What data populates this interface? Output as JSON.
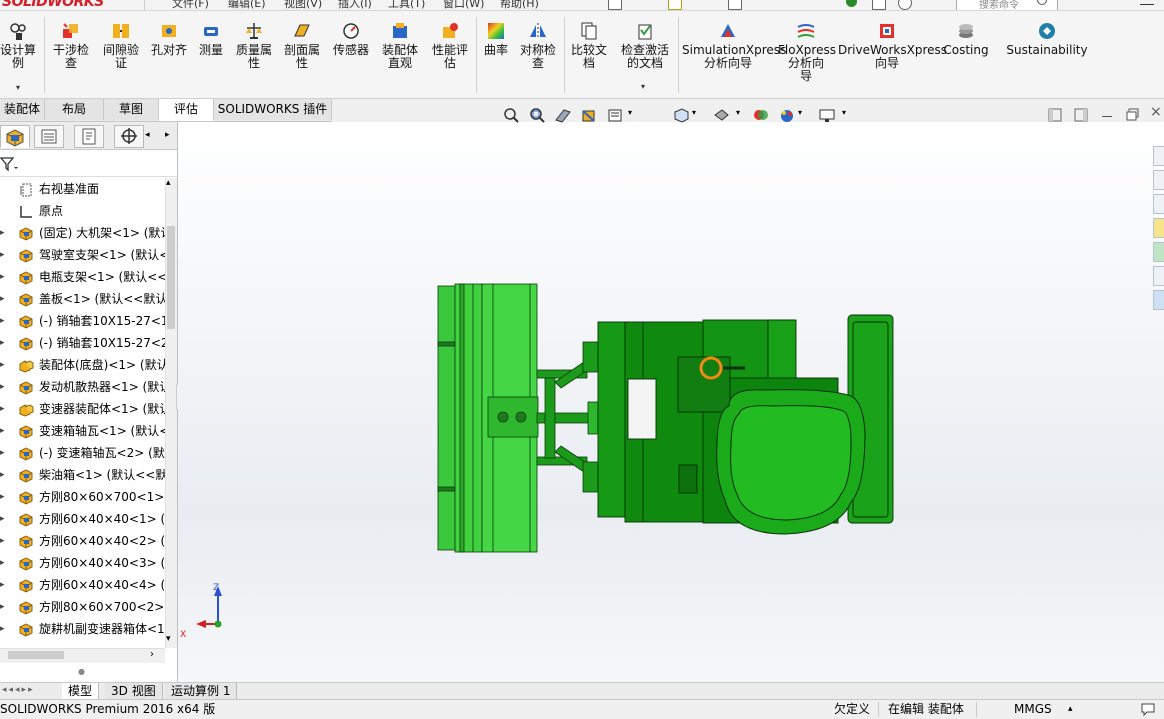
{
  "app": {
    "logo_text": "SOLIDWORKS",
    "menu": [
      "文件(F)",
      "编辑(E)",
      "视图(V)",
      "插入(I)",
      "工具(T)",
      "窗口(W)",
      "帮助(H)"
    ],
    "search_placeholder": "搜索命令"
  },
  "ribbon": {
    "commands": [
      {
        "label": "设计算\n例",
        "icon": "design-study-icon"
      },
      {
        "label": "干涉检\n查",
        "icon": "interference-check-icon"
      },
      {
        "label": "间隙验\n证",
        "icon": "clearance-verification-icon"
      },
      {
        "label": "孔对齐",
        "icon": "hole-alignment-icon"
      },
      {
        "label": "测量",
        "icon": "measure-icon"
      },
      {
        "label": "质量属\n性",
        "icon": "mass-properties-icon"
      },
      {
        "label": "剖面属\n性",
        "icon": "section-properties-icon"
      },
      {
        "label": "传感器",
        "icon": "sensor-icon"
      },
      {
        "label": "装配体\n直观",
        "icon": "assemblyxpert-icon"
      },
      {
        "label": "性能评\n估",
        "icon": "performance-evaluation-icon"
      },
      {
        "label": "曲率",
        "icon": "curvature-icon"
      },
      {
        "label": "对称检\n查",
        "icon": "symmetry-check-icon"
      },
      {
        "label": "比较文\n档",
        "icon": "compare-documents-icon"
      },
      {
        "label": "检查激活\n的文档",
        "icon": "check-active-document-icon"
      },
      {
        "label": "SimulationXpress\n分析向导",
        "icon": "simulationxpress-icon"
      },
      {
        "label": "FloXpress\n分析向\n导",
        "icon": "floxpress-icon"
      },
      {
        "label": "DriveWorksXpress\n向导",
        "icon": "driveworksxpress-icon"
      },
      {
        "label": "Costing",
        "icon": "costing-icon"
      },
      {
        "label": "Sustainability",
        "icon": "sustainability-icon"
      }
    ]
  },
  "tabs": [
    {
      "label": "装配体"
    },
    {
      "label": "布局"
    },
    {
      "label": "草图"
    },
    {
      "label": "评估"
    },
    {
      "label": "SOLIDWORKS 插件"
    }
  ],
  "feature_tree": {
    "items": [
      {
        "label": "右视基准面",
        "icon": "plane-icon"
      },
      {
        "label": "原点",
        "icon": "origin-icon"
      },
      {
        "label": "(固定) 大机架<1> (默认",
        "icon": "part-icon"
      },
      {
        "label": "驾驶室支架<1> (默认<",
        "icon": "part-icon"
      },
      {
        "label": "电瓶支架<1> (默认<<",
        "icon": "part-icon"
      },
      {
        "label": "盖板<1> (默认<<默认",
        "icon": "part-icon"
      },
      {
        "label": "(-) 销轴套10X15-27<1",
        "icon": "part-icon"
      },
      {
        "label": "(-) 销轴套10X15-27<2",
        "icon": "part-icon"
      },
      {
        "label": "装配体(底盘)<1> (默认",
        "icon": "assembly-icon"
      },
      {
        "label": "发动机散热器<1> (默认",
        "icon": "part-icon"
      },
      {
        "label": "变速器装配体<1> (默认",
        "icon": "assembly-icon"
      },
      {
        "label": "变速箱轴瓦<1> (默认<",
        "icon": "part-icon"
      },
      {
        "label": "(-) 变速箱轴瓦<2> (默",
        "icon": "part-icon"
      },
      {
        "label": "柴油箱<1> (默认<<默",
        "icon": "part-icon"
      },
      {
        "label": "方刚80×60×700<1> (",
        "icon": "part-icon"
      },
      {
        "label": "方刚60×40×40<1> (默",
        "icon": "part-icon"
      },
      {
        "label": "方刚60×40×40<2> (默",
        "icon": "part-icon"
      },
      {
        "label": "方刚60×40×40<3> (默",
        "icon": "part-icon"
      },
      {
        "label": "方刚60×40×40<4> (默",
        "icon": "part-icon"
      },
      {
        "label": "方刚80×60×700<2> (",
        "icon": "part-icon"
      },
      {
        "label": "旋耕机副变速器箱体<1",
        "icon": "part-icon"
      }
    ]
  },
  "triad": {
    "z_label": "Z",
    "x_label": "X"
  },
  "bottom_tabs": [
    {
      "label": "模型"
    },
    {
      "label": "3D 视图"
    },
    {
      "label": "运动算例 1"
    }
  ],
  "status": {
    "product": "SOLIDWORKS Premium 2016 x64 版",
    "definition": "欠定义",
    "mode": "在编辑 装配体",
    "units": "MMGS"
  },
  "colors": {
    "model_dark_green": "#0f8a0f",
    "model_light_green": "#43d143",
    "accent_orange": "#f08a10",
    "logo_red": "#d4202a"
  }
}
